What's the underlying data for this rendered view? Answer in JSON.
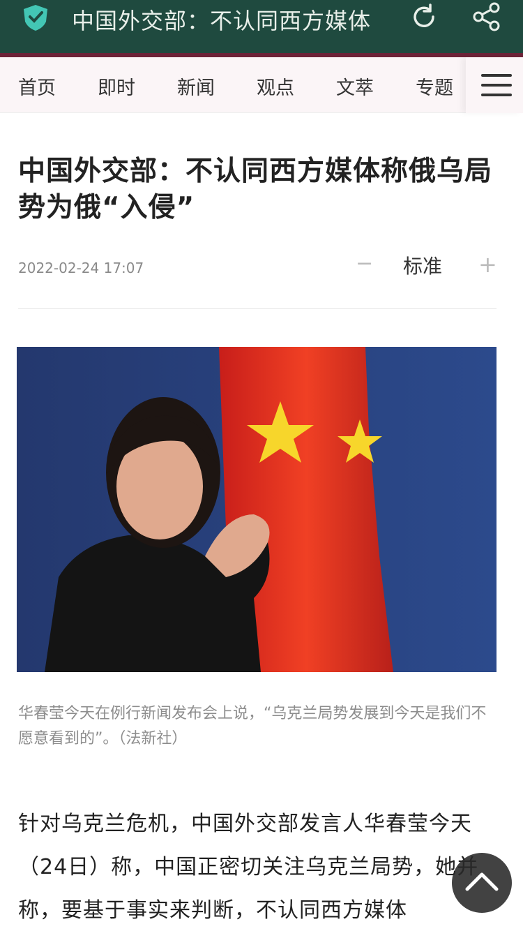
{
  "browser": {
    "title": "中国外交部：不认同西方媒体",
    "icons": [
      "shield-icon",
      "reload-icon",
      "share-icon"
    ]
  },
  "nav": {
    "items": [
      "首页",
      "即时",
      "新闻",
      "观点",
      "文萃",
      "专题"
    ],
    "menu_icon": "hamburger-icon"
  },
  "article": {
    "headline": "中国外交部：不认同西方媒体称俄乌局势为俄“入侵”",
    "date": "2022-02-24 17:07",
    "font_size_label": "标准",
    "font_minus": "−",
    "font_plus": "+",
    "caption": "华春莹今天在例行新闻发布会上说，“乌克兰局势发展到今天是我们不愿意看到的”。（法新社）",
    "body": "针对乌克兰危机，中国外交部发言人华春莹今天（24日）称，中国正密切关注乌克兰局势，她并称，要基于事实来判断，不认同西方媒体"
  },
  "colors": {
    "topbar": "#1f4a3f",
    "accent": "#6d2338",
    "nav_bg": "#fbf5f7"
  }
}
